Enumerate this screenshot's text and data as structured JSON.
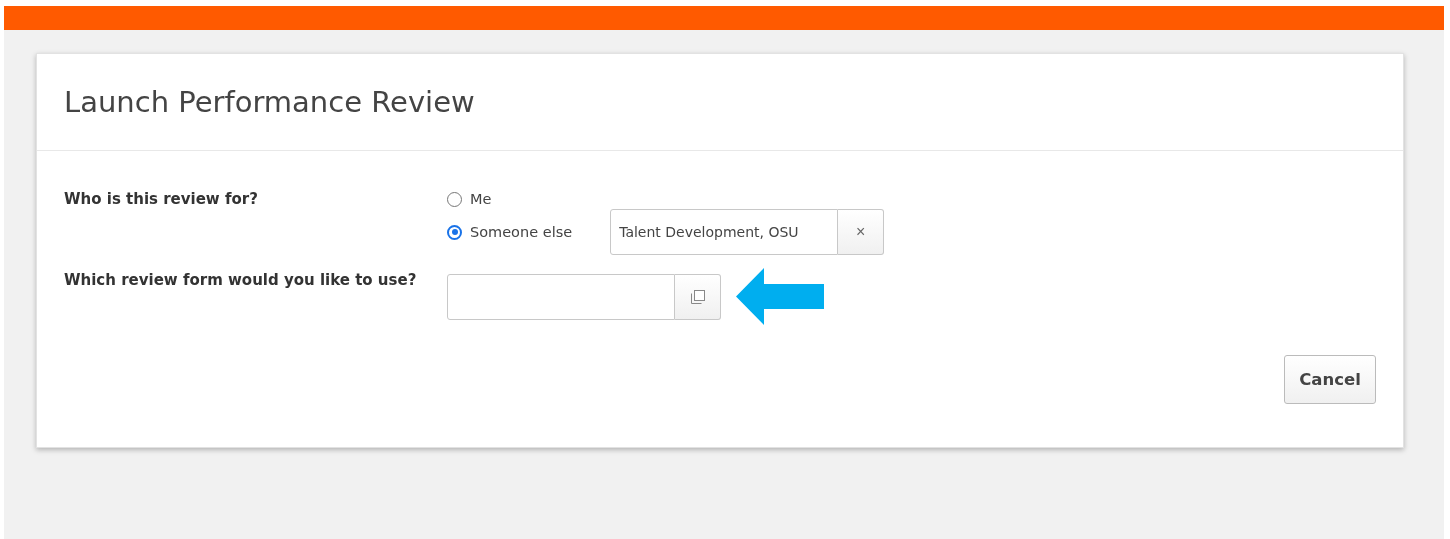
{
  "dialog": {
    "title": "Launch Performance Review",
    "questions": [
      {
        "label": "Who is this review for?"
      },
      {
        "label": "Which review form would you like to use?"
      }
    ],
    "recipient_options": [
      {
        "label": "Me",
        "selected": false
      },
      {
        "label": "Someone else",
        "selected": true
      }
    ],
    "recipient_field": {
      "value": "Talent Development, OSU",
      "clear_button": "×"
    },
    "buttons": [
      "Cancel"
    ]
  }
}
